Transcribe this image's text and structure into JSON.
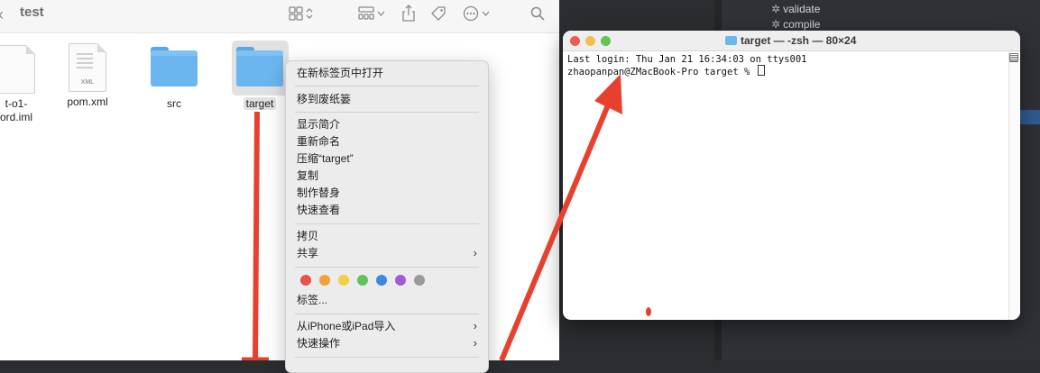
{
  "finder": {
    "title": "test",
    "files": [
      {
        "name": "t-o1-\nord.iml",
        "kind": "document"
      },
      {
        "name": "pom.xml",
        "kind": "xml",
        "badge": "XML"
      },
      {
        "name": "src",
        "kind": "folder"
      },
      {
        "name": "target",
        "kind": "folder",
        "selected": true
      }
    ],
    "toolbar_icons": [
      "view-grid-icon",
      "group-icon",
      "share-icon",
      "tag-icon",
      "more-icon",
      "search-icon"
    ]
  },
  "context_menu": {
    "open_in_new_tab": "在新标签页中打开",
    "move_to_trash": "移到废纸篓",
    "get_info": "显示简介",
    "rename": "重新命名",
    "compress": "压缩“target”",
    "duplicate": "复制",
    "make_alias": "制作替身",
    "quick_look": "快速查看",
    "copy": "拷贝",
    "share": "共享",
    "tags": "标签...",
    "import_from_iphone": "从iPhone或iPad导入",
    "quick_actions": "快速操作",
    "tag_colors": [
      "#e5534b",
      "#f0a13a",
      "#f4cf42",
      "#5ec35c",
      "#3b87e4",
      "#a35bd1",
      "#9a9a9a"
    ]
  },
  "ide": {
    "maven_items": [
      "validate",
      "compile"
    ]
  },
  "terminal": {
    "title": "target — -zsh — 80×24",
    "line1": "Last login: Thu Jan 21 16:34:03 on ttys001",
    "line2": "zhaopanpan@ZMacBook-Pro target % "
  },
  "colors": {
    "annotation_red": "#e8402e",
    "traffic_close": "#ee5c54",
    "traffic_min": "#f5bd4f",
    "traffic_max": "#61c454"
  }
}
